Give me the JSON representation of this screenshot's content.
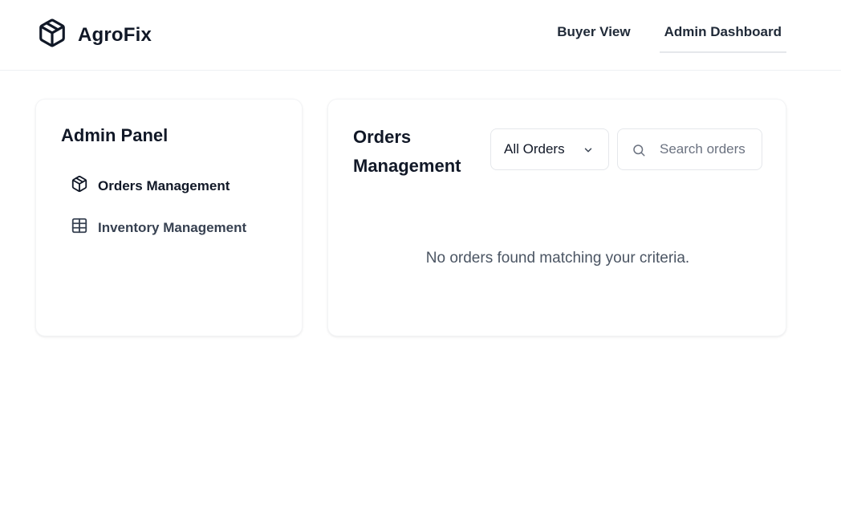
{
  "app": {
    "name": "AgroFix",
    "logo_icon": "package-icon"
  },
  "nav": {
    "items": [
      {
        "label": "Buyer View",
        "active": false
      },
      {
        "label": "Admin Dashboard",
        "active": true
      }
    ]
  },
  "sidebar": {
    "title": "Admin Panel",
    "items": [
      {
        "label": "Orders Management",
        "icon": "package-icon",
        "active": true
      },
      {
        "label": "Inventory Management",
        "icon": "table-icon",
        "active": false
      }
    ]
  },
  "main": {
    "title": "Orders Management",
    "filter": {
      "selected": "All Orders",
      "icon": "chevron-down-icon"
    },
    "search": {
      "placeholder": "Search orders",
      "value": "",
      "icon": "search-icon"
    },
    "empty_message": "No orders found matching your criteria."
  },
  "colors": {
    "text_primary": "#111827",
    "text_secondary": "#4b5563",
    "border": "#e5e7eb",
    "background": "#ffffff"
  }
}
